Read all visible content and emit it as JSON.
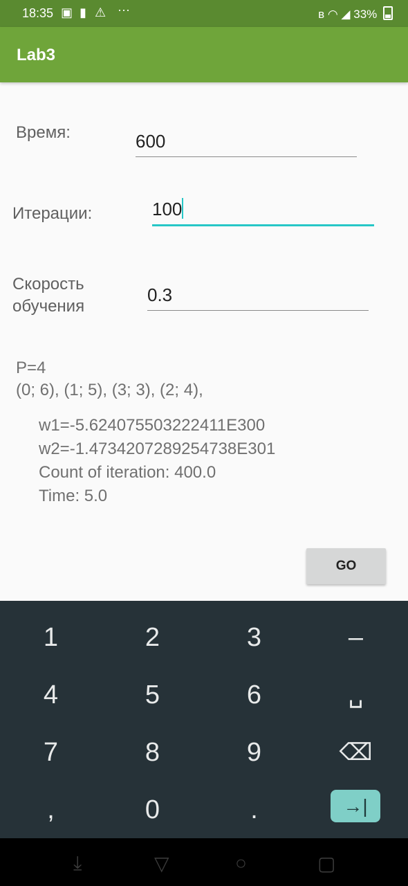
{
  "status_bar": {
    "time": "18:35",
    "battery": "33%",
    "icons": [
      "image-icon",
      "sim-icon",
      "warning-icon",
      "more-dots-icon",
      "bluetooth-icon",
      "wifi-icon",
      "signal-icon",
      "battery-icon"
    ]
  },
  "app_bar": {
    "title": "Lab3"
  },
  "form": {
    "time_label": "Время:",
    "time_value": "600",
    "iterations_label": "Итерации:",
    "iterations_value": "100",
    "rate_label_line1": "Скорость",
    "rate_label_line2": "обучения",
    "rate_value": "0.3"
  },
  "output": {
    "p_line": "P=4",
    "points_line": "(0; 6), (1; 5), (3; 3), (2; 4),",
    "w1": "w1=-5.624075503222411E300",
    "w2": "w2=-1.4734207289254738E301",
    "count": "Count of iteration: 400.0",
    "time": "Time: 5.0"
  },
  "go_button": {
    "label": "GO"
  },
  "keyboard": {
    "row1": [
      "1",
      "2",
      "3",
      "–"
    ],
    "row2": [
      "4",
      "5",
      "6",
      "␣"
    ],
    "row3": [
      "7",
      "8",
      "9",
      "⌫"
    ],
    "row4": [
      ",",
      "0",
      ".",
      "→|"
    ]
  },
  "nav_bar": {
    "icons": [
      "back-icon",
      "home-icon",
      "recents-icon",
      "hide-keyboard-icon"
    ]
  },
  "colors": {
    "status_bar": "#5a8a30",
    "app_bar": "#6fa53a",
    "accent": "#26c6c6",
    "keyboard_bg": "#263238",
    "enter_key": "#7fcfc7"
  }
}
